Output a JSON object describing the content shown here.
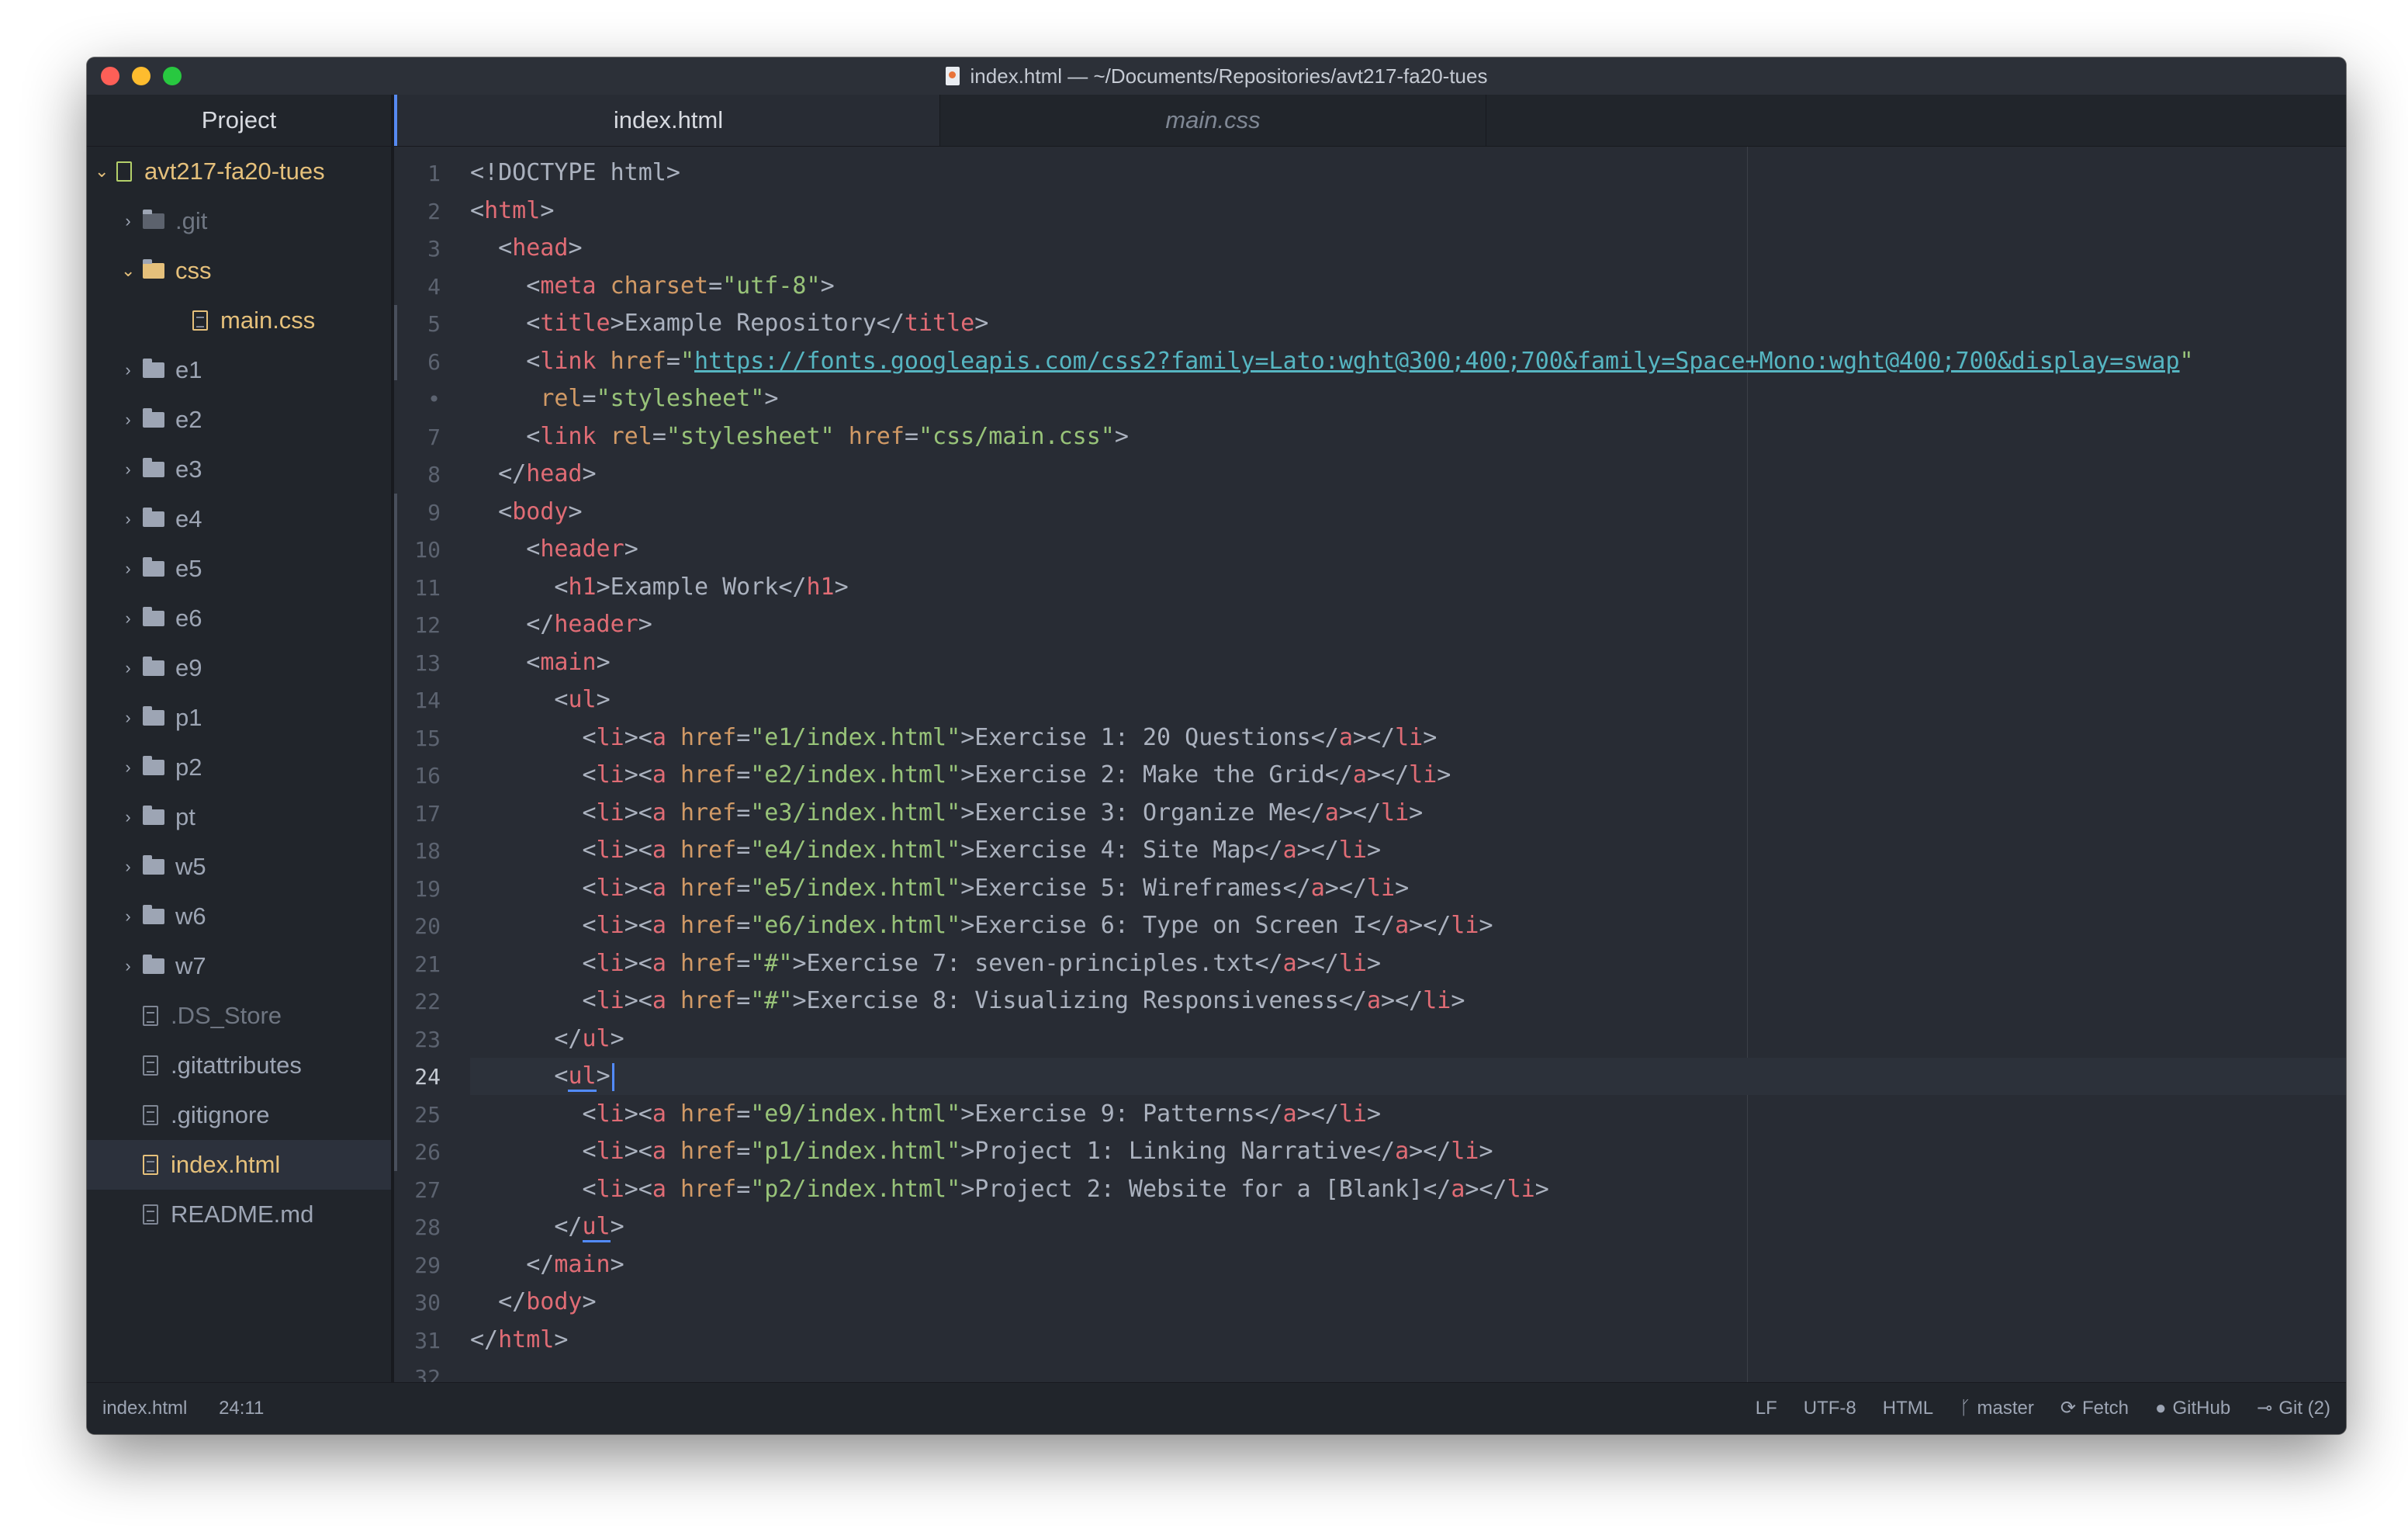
{
  "window": {
    "title": "index.html — ~/Documents/Repositories/avt217-fa20-tues"
  },
  "sidebar": {
    "header": "Project",
    "root": "avt217-fa20-tues",
    "items": [
      {
        "label": ".git",
        "type": "folder",
        "expanded": false,
        "style": "dim"
      },
      {
        "label": "css",
        "type": "folder",
        "expanded": true,
        "style": "yellow"
      },
      {
        "label": "main.css",
        "type": "file",
        "style": "yellow",
        "indent": 2
      },
      {
        "label": "e1",
        "type": "folder",
        "expanded": false,
        "style": "normal"
      },
      {
        "label": "e2",
        "type": "folder",
        "expanded": false,
        "style": "normal"
      },
      {
        "label": "e3",
        "type": "folder",
        "expanded": false,
        "style": "normal"
      },
      {
        "label": "e4",
        "type": "folder",
        "expanded": false,
        "style": "normal"
      },
      {
        "label": "e5",
        "type": "folder",
        "expanded": false,
        "style": "normal"
      },
      {
        "label": "e6",
        "type": "folder",
        "expanded": false,
        "style": "normal"
      },
      {
        "label": "e9",
        "type": "folder",
        "expanded": false,
        "style": "normal"
      },
      {
        "label": "p1",
        "type": "folder",
        "expanded": false,
        "style": "normal"
      },
      {
        "label": "p2",
        "type": "folder",
        "expanded": false,
        "style": "normal"
      },
      {
        "label": "pt",
        "type": "folder",
        "expanded": false,
        "style": "normal"
      },
      {
        "label": "w5",
        "type": "folder",
        "expanded": false,
        "style": "normal"
      },
      {
        "label": "w6",
        "type": "folder",
        "expanded": false,
        "style": "normal"
      },
      {
        "label": "w7",
        "type": "folder",
        "expanded": false,
        "style": "normal"
      },
      {
        "label": ".DS_Store",
        "type": "file",
        "style": "dim"
      },
      {
        "label": ".gitattributes",
        "type": "file",
        "style": "normal"
      },
      {
        "label": ".gitignore",
        "type": "file",
        "style": "normal"
      },
      {
        "label": "index.html",
        "type": "file",
        "style": "yellow",
        "selected": true
      },
      {
        "label": "README.md",
        "type": "file-md",
        "style": "normal"
      }
    ]
  },
  "tabs": [
    {
      "label": "index.html",
      "active": true
    },
    {
      "label": "main.css",
      "active": false
    }
  ],
  "editor": {
    "gutter": [
      "1",
      "2",
      "3",
      "4",
      "5",
      "6",
      "•",
      "7",
      "8",
      "9",
      "10",
      "11",
      "12",
      "13",
      "14",
      "15",
      "16",
      "17",
      "18",
      "19",
      "20",
      "21",
      "22",
      "23",
      "24",
      "25",
      "26",
      "27",
      "28",
      "29",
      "30",
      "31",
      "32"
    ],
    "current_line": "24",
    "lines": [
      "<!DOCTYPE html>",
      "<html>",
      "  <head>",
      "    <meta charset=\"utf-8\">",
      "    <title>Example Repository</title>",
      "    <link href=\"https://fonts.googleapis.com/css2?family=Lato:wght@300;400;700&family=Space+Mono:wght@400;700&display=swap\"",
      "     rel=\"stylesheet\">",
      "    <link rel=\"stylesheet\" href=\"css/main.css\">",
      "  </head>",
      "  <body>",
      "    <header>",
      "      <h1>Example Work</h1>",
      "    </header>",
      "    <main>",
      "      <ul>",
      "        <li><a href=\"e1/index.html\">Exercise 1: 20 Questions</a></li>",
      "        <li><a href=\"e2/index.html\">Exercise 2: Make the Grid</a></li>",
      "        <li><a href=\"e3/index.html\">Exercise 3: Organize Me</a></li>",
      "        <li><a href=\"e4/index.html\">Exercise 4: Site Map</a></li>",
      "        <li><a href=\"e5/index.html\">Exercise 5: Wireframes</a></li>",
      "        <li><a href=\"e6/index.html\">Exercise 6: Type on Screen I</a></li>",
      "        <li><a href=\"#\">Exercise 7: seven-principles.txt</a></li>",
      "        <li><a href=\"#\">Exercise 8: Visualizing Responsiveness</a></li>",
      "      </ul>",
      "      <ul>",
      "        <li><a href=\"e9/index.html\">Exercise 9: Patterns</a></li>",
      "        <li><a href=\"p1/index.html\">Project 1: Linking Narrative</a></li>",
      "        <li><a href=\"p2/index.html\">Project 2: Website for a [Blank]</a></li>",
      "      </ul>",
      "    </main>",
      "  </body>",
      "</html>",
      ""
    ]
  },
  "statusbar": {
    "file": "index.html",
    "cursor": "24:11",
    "line_ending": "LF",
    "encoding": "UTF-8",
    "grammar": "HTML",
    "branch": "master",
    "fetch": "Fetch",
    "github": "GitHub",
    "git": "Git (2)"
  },
  "colors": {
    "accent": "#568af2",
    "tag": "#e06c75",
    "attribute": "#d19a66",
    "string": "#98c379",
    "url": "#56b6c2"
  }
}
